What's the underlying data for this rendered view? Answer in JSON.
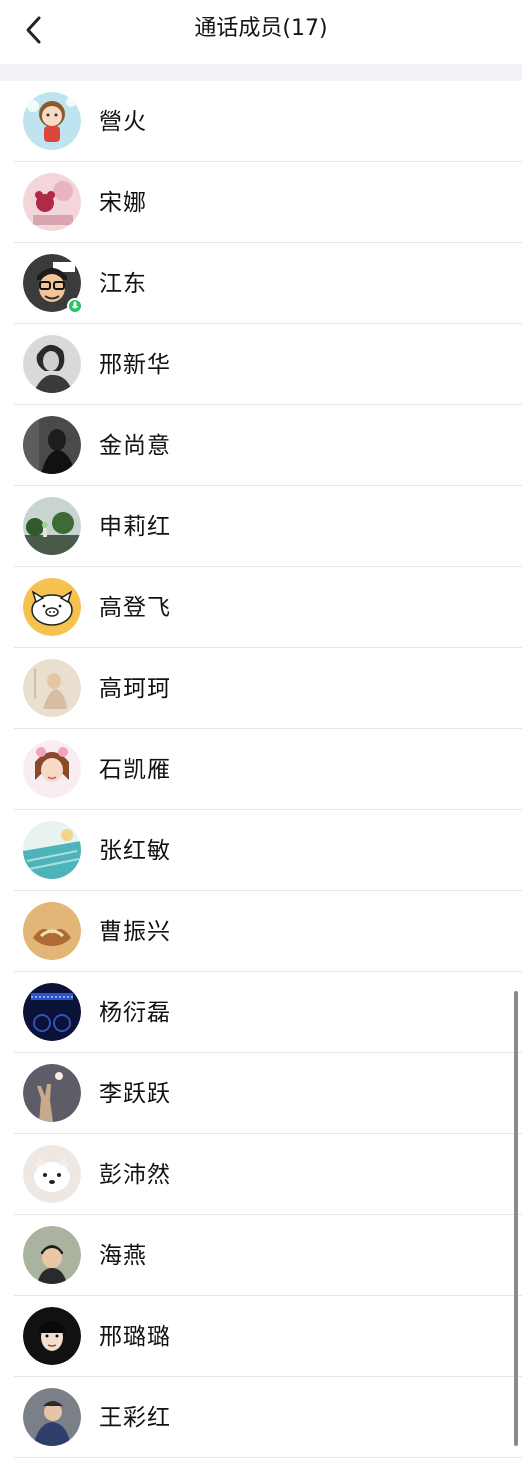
{
  "header": {
    "title": "通话成员(17)"
  },
  "members": [
    {
      "name": "營火",
      "avatar": "girl-cartoon-avatar"
    },
    {
      "name": "宋娜",
      "avatar": "bear-toys-avatar"
    },
    {
      "name": "江东",
      "avatar": "glasses-cartoon-avatar",
      "speaking": true
    },
    {
      "name": "邢新华",
      "avatar": "bw-portrait-avatar"
    },
    {
      "name": "金尚意",
      "avatar": "dark-portrait-avatar"
    },
    {
      "name": "申莉红",
      "avatar": "trees-street-avatar"
    },
    {
      "name": "高登飞",
      "avatar": "pig-cartoon-avatar"
    },
    {
      "name": "高珂珂",
      "avatar": "sketch-girl-avatar"
    },
    {
      "name": "石凯雁",
      "avatar": "pink-girl-avatar"
    },
    {
      "name": "张红敏",
      "avatar": "pool-illustration-avatar"
    },
    {
      "name": "曹振兴",
      "avatar": "heart-hands-avatar"
    },
    {
      "name": "杨衍磊",
      "avatar": "night-stage-avatar"
    },
    {
      "name": "李跃跃",
      "avatar": "moon-hand-avatar"
    },
    {
      "name": "彭沛然",
      "avatar": "white-dog-avatar"
    },
    {
      "name": "海燕",
      "avatar": "child-photo-avatar"
    },
    {
      "name": "邢璐璐",
      "avatar": "audrey-portrait-avatar"
    },
    {
      "name": "王彩红",
      "avatar": "baby-photo-avatar"
    }
  ],
  "colors": {
    "separator": "#e7e7e9",
    "gap": "#f2f3f7",
    "mic_badge": "#22c55e"
  }
}
